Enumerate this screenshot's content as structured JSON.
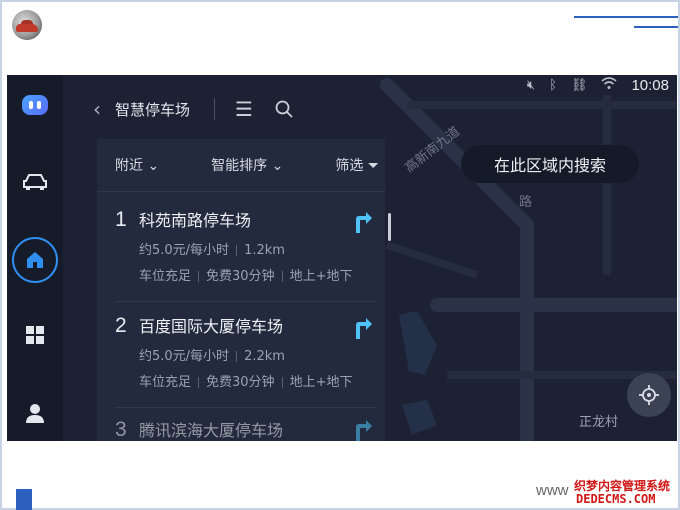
{
  "status_bar": {
    "time": "10:08",
    "icons": [
      "mute-icon",
      "bluetooth-icon",
      "link-icon",
      "wifi-icon"
    ]
  },
  "sidebar": {
    "items": [
      {
        "name": "assistant",
        "icon": "assistant-icon"
      },
      {
        "name": "vehicle",
        "icon": "car-icon"
      },
      {
        "name": "home",
        "icon": "home-icon",
        "active": true
      },
      {
        "name": "apps",
        "icon": "apps-grid-icon"
      },
      {
        "name": "profile",
        "icon": "user-icon"
      }
    ]
  },
  "panel": {
    "title": "智慧停车场",
    "filters": {
      "nearby": "附近",
      "sort": "智能排序",
      "filter": "筛选"
    },
    "results": [
      {
        "index": "1",
        "name": "科苑南路停车场",
        "price": "约5.0元/每小时",
        "distance": "1.2km",
        "availability": "车位充足",
        "free_time": "免费30分钟",
        "levels": "地上+地下"
      },
      {
        "index": "2",
        "name": "百度国际大厦停车场",
        "price": "约5.0元/每小时",
        "distance": "2.2km",
        "availability": "车位充足",
        "free_time": "免费30分钟",
        "levels": "地上+地下"
      },
      {
        "index": "3",
        "name": "腾讯滨海大厦停车场"
      }
    ]
  },
  "map": {
    "area_search_label": "在此区域内搜索",
    "labels": {
      "road1": "高新南九道",
      "road2": "路",
      "place1": "正龙村"
    }
  },
  "footer": {
    "www": "www",
    "watermark_line1": "织梦内容管理系统",
    "watermark_line2": "DEDECMS.COM"
  },
  "colors": {
    "accent": "#2f8ff0",
    "nav_arrow": "#4fc3f7",
    "screen_bg": "#1c2233",
    "deco_blue": "#2d5fbf"
  }
}
